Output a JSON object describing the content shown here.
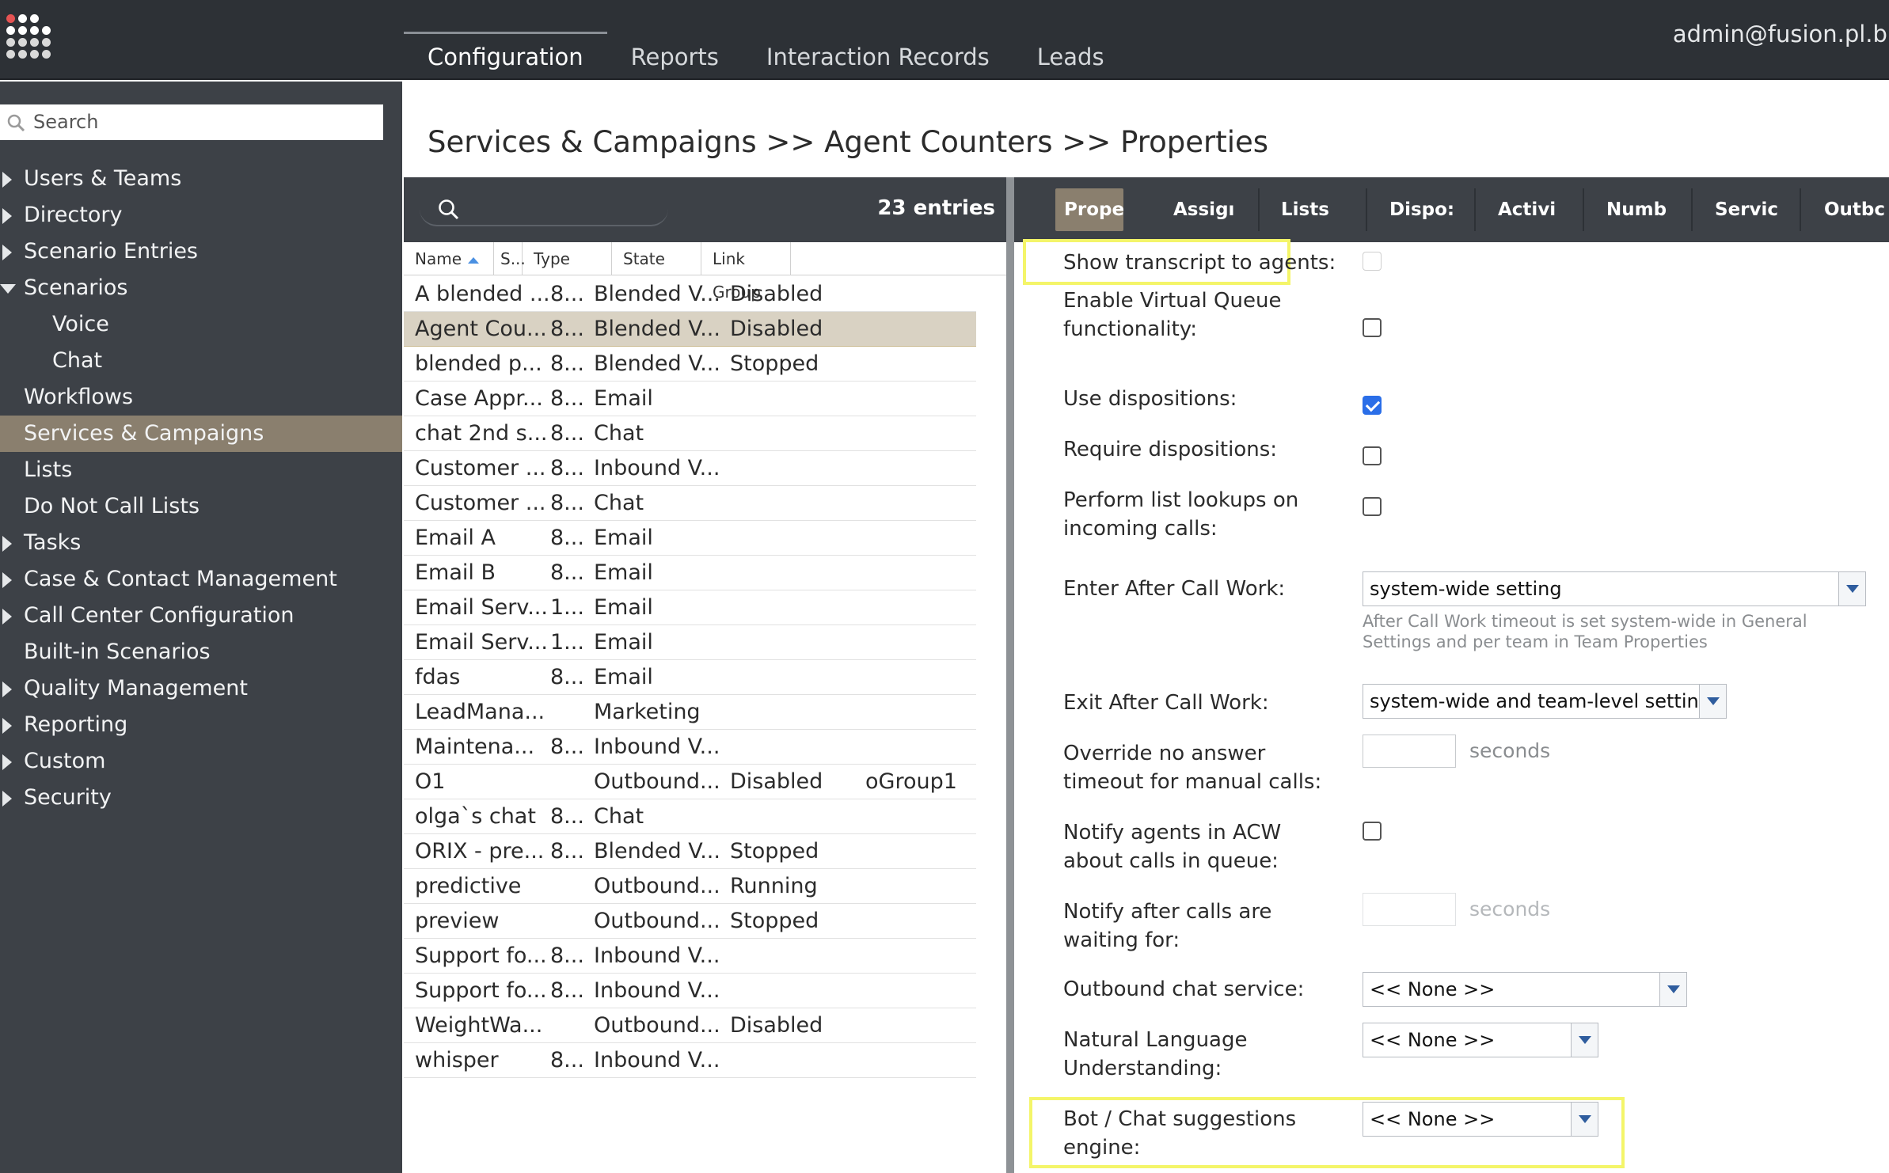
{
  "topbar": {
    "tabs": [
      "Configuration",
      "Reports",
      "Interaction Records",
      "Leads"
    ],
    "user": "admin@fusion.pl.bi"
  },
  "sidebar": {
    "search_placeholder": "Search",
    "items": [
      {
        "label": "Users & Teams",
        "arrow": "right"
      },
      {
        "label": "Directory",
        "arrow": "right"
      },
      {
        "label": "Scenario Entries",
        "arrow": "right"
      },
      {
        "label": "Scenarios",
        "arrow": "down"
      },
      {
        "label": "Voice",
        "sub": true
      },
      {
        "label": "Chat",
        "sub": true
      },
      {
        "label": "Workflows"
      },
      {
        "label": "Services & Campaigns",
        "selected": true
      },
      {
        "label": "Lists"
      },
      {
        "label": "Do Not Call Lists"
      },
      {
        "label": "Tasks",
        "arrow": "right"
      },
      {
        "label": "Case & Contact Management",
        "arrow": "right"
      },
      {
        "label": "Call Center Configuration",
        "arrow": "right"
      },
      {
        "label": "Built-in Scenarios"
      },
      {
        "label": "Quality Management",
        "arrow": "right"
      },
      {
        "label": "Reporting",
        "arrow": "right"
      },
      {
        "label": "Custom",
        "arrow": "right"
      },
      {
        "label": "Security",
        "arrow": "right"
      }
    ]
  },
  "heading": "Services & Campaigns >> Agent Counters >> Properties",
  "list": {
    "entries": "23 entries",
    "columns": [
      "Name",
      "S...",
      "Type",
      "State",
      "Link Group"
    ],
    "rows": [
      [
        "A blended ...",
        "8...",
        "Blended V...",
        "Disabled",
        ""
      ],
      [
        "Agent Cou...",
        "8...",
        "Blended V...",
        "Disabled",
        ""
      ],
      [
        "blended p...",
        "8...",
        "Blended V...",
        "Stopped",
        ""
      ],
      [
        "Case Appr...",
        "8...",
        "Email",
        "",
        ""
      ],
      [
        "chat 2nd s...",
        "8...",
        "Chat",
        "",
        ""
      ],
      [
        "Customer ...",
        "8...",
        "Inbound V...",
        "",
        ""
      ],
      [
        "Customer ...",
        "8...",
        "Chat",
        "",
        ""
      ],
      [
        "Email A",
        "8...",
        "Email",
        "",
        ""
      ],
      [
        "Email B",
        "8...",
        "Email",
        "",
        ""
      ],
      [
        "Email Serv...",
        "1...",
        "Email",
        "",
        ""
      ],
      [
        "Email Serv...",
        "1...",
        "Email",
        "",
        ""
      ],
      [
        "fdas",
        "8...",
        "Email",
        "",
        ""
      ],
      [
        "LeadMana...",
        "",
        "Marketing",
        "",
        ""
      ],
      [
        "Maintena...",
        "8...",
        "Inbound V...",
        "",
        ""
      ],
      [
        "O1",
        "",
        "Outbound...",
        "Disabled",
        "oGroup1"
      ],
      [
        "olga`s chat",
        "8...",
        "Chat",
        "",
        ""
      ],
      [
        "ORIX - pre...",
        "8...",
        "Blended V...",
        "Stopped",
        ""
      ],
      [
        "predictive",
        "",
        "Outbound...",
        "Running",
        ""
      ],
      [
        "preview",
        "",
        "Outbound...",
        "Stopped",
        ""
      ],
      [
        "Support fo...",
        "8...",
        "Inbound V...",
        "",
        ""
      ],
      [
        "Support fo...",
        "8...",
        "Inbound V...",
        "",
        ""
      ],
      [
        "WeightWa...",
        "",
        "Outbound...",
        "Disabled",
        ""
      ],
      [
        "whisper",
        "8...",
        "Inbound V...",
        "",
        ""
      ]
    ],
    "selected_row": 1
  },
  "prop_tabs": [
    "Prope",
    "Assigı",
    "Lists",
    "Dispo:",
    "Activi",
    "Numb",
    "Servic",
    "Outbc"
  ],
  "props": {
    "show_transcript": {
      "label": "Show transcript to agents:",
      "checked": false,
      "disabled": true
    },
    "virtual_queue": {
      "label": "Enable Virtual Queue functionality:",
      "checked": false
    },
    "use_dispositions": {
      "label": "Use dispositions:",
      "checked": true
    },
    "require_dispositions": {
      "label": "Require dispositions:",
      "checked": false
    },
    "list_lookups": {
      "label": "Perform list lookups on incoming calls:",
      "checked": false
    },
    "enter_acw": {
      "label": "Enter After Call Work:",
      "value": "system-wide setting",
      "hint": "After Call Work timeout is set system-wide in General Settings and per team in Team Properties"
    },
    "exit_acw": {
      "label": "Exit After Call Work:",
      "value": "system-wide and team-level setting"
    },
    "override_timeout": {
      "label": "Override no answer timeout for manual calls:",
      "value": "",
      "unit": "seconds"
    },
    "notify_acw": {
      "label": "Notify agents in ACW about calls in queue:",
      "checked": false
    },
    "notify_after": {
      "label": "Notify after calls are waiting for:",
      "value": "",
      "unit": "seconds"
    },
    "outbound_chat": {
      "label": "Outbound chat service:",
      "value": "<< None >>"
    },
    "nlu": {
      "label": "Natural Language Understanding:",
      "value": "<< None >>"
    },
    "bot_engine": {
      "label": "Bot / Chat suggestions engine:",
      "value": "<< None >>"
    }
  }
}
